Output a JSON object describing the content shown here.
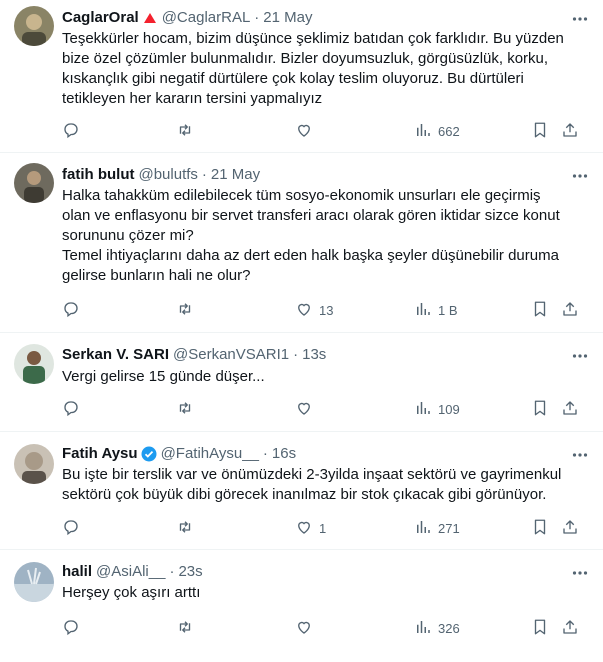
{
  "tweets": [
    {
      "name": "CaglarOral",
      "handle": "@CaglarRAL",
      "sep": "·",
      "time": "21 May",
      "text": "Teşekkürler hocam, bizim düşünce şeklimiz batıdan çok farklıdır. Bu yüzden\nbize özel çözümler bulunmalıdır. Bizler doyumsuzluk, görgüsüzlük, korku,\nkıskançlık gibi negatif dürtülere çok kolay teslim oluyoruz. Bu dürtüleri\ntetikleyen her kararın tersini yapmalıyız",
      "replies": "",
      "retweets": "",
      "likes": "",
      "views": "662",
      "avatar_color": "#8a8466"
    },
    {
      "name": "fatih bulut",
      "handle": "@bulutfs",
      "sep": "·",
      "time": "21 May",
      "text": "Halka tahakküm edilebilecek tüm sosyo-ekonomik unsurları ele geçirmiş\nolan ve enflasyonu bir servet transferi aracı olarak gören iktidar sizce konut\nsorununu çözer mi?\nTemel ihtiyaçlarını daha az dert eden halk başka şeyler düşünebilir duruma\ngelirse bunların hali ne olur?",
      "replies": "",
      "retweets": "",
      "likes": "13",
      "views": "1 B",
      "avatar_color": "#6e6a5e"
    },
    {
      "name": "Serkan V. SARI",
      "handle": "@SerkanVSARI1",
      "sep": "·",
      "time": "13s",
      "text": "Vergi gelirse 15 günde düşer...",
      "replies": "",
      "retweets": "",
      "likes": "",
      "views": "109",
      "avatar_color": "#3c6a4a"
    },
    {
      "name": "Fatih Aysu",
      "handle": "@FatihAysu__",
      "sep": "·",
      "time": "16s",
      "text": "Bu işte bir terslik var ve önümüzdeki 2-3yilda inşaat sektörü ve gayrimenkul\nsektörü çok büyük dibi görecek inanılmaz bir stok çıkacak gibi görünüyor.",
      "replies": "",
      "retweets": "",
      "likes": "1",
      "views": "271",
      "avatar_color": "#a89a88"
    },
    {
      "name": "halil",
      "handle": "@AsiAli__",
      "sep": "·",
      "time": "23s",
      "text": "Herşey çok aşırı arttı",
      "replies": "",
      "retweets": "",
      "likes": "",
      "views": "326",
      "avatar_color": "#9fb3c4"
    }
  ],
  "colors": {
    "text": "#0f1419",
    "muted": "#536471",
    "border": "#eff3f4",
    "verified": "#1d9bf0",
    "warning": "#f4212e"
  },
  "icons": [
    "more-icon",
    "reply-icon",
    "retweet-icon",
    "like-icon",
    "views-icon",
    "bookmark-icon",
    "share-icon",
    "verified-badge-icon",
    "warning-triangle-icon"
  ]
}
